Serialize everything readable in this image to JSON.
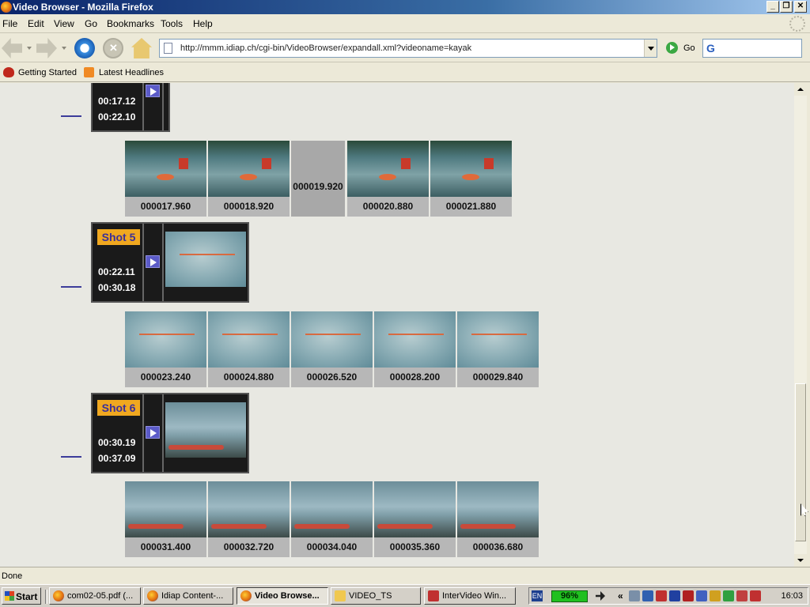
{
  "window": {
    "title": "Video Browser - Mozilla Firefox",
    "min": "_",
    "max": "❐",
    "close": "✕"
  },
  "menu": [
    "File",
    "Edit",
    "View",
    "Go",
    "Bookmarks",
    "Tools",
    "Help"
  ],
  "nav": {
    "url": "http://mmm.idiap.ch/cgi-bin/VideoBrowser/expandall.xml?videoname=kayak",
    "go_label": "Go",
    "search_icon": "G"
  },
  "bookmarks": [
    "Getting Started",
    "Latest Headlines"
  ],
  "shots": [
    {
      "label": "",
      "start": "00:17.12",
      "end": "00:22.10",
      "keyframes": [
        "000017.960",
        "000018.920",
        "000019.920",
        "000020.880",
        "000021.880"
      ]
    },
    {
      "label": "Shot 5",
      "start": "00:22.11",
      "end": "00:30.18",
      "keyframes": [
        "000023.240",
        "000024.880",
        "000026.520",
        "000028.200",
        "000029.840"
      ]
    },
    {
      "label": "Shot 6",
      "start": "00:30.19",
      "end": "00:37.09",
      "keyframes": [
        "000031.400",
        "000032.720",
        "000034.040",
        "000035.360",
        "000036.680"
      ]
    }
  ],
  "status": "Done",
  "taskbar": {
    "start": "Start",
    "tasks": [
      "com02-05.pdf (...",
      "Idiap Content-...",
      "Video Browse...",
      "VIDEO_TS",
      "InterVideo Win..."
    ],
    "lang": "EN",
    "battery": "96%",
    "chevron": "«",
    "clock": "16:03"
  }
}
